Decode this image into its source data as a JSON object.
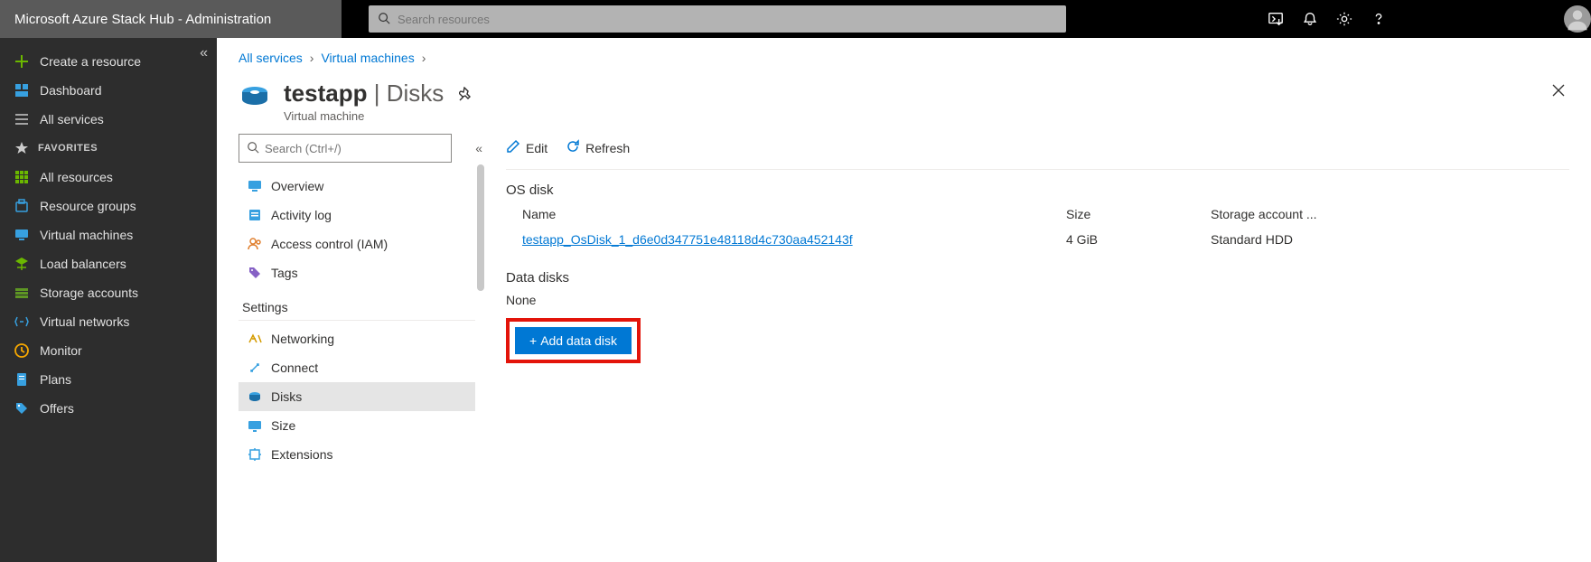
{
  "topbar": {
    "title": "Microsoft Azure Stack Hub - Administration",
    "search_placeholder": "Search resources"
  },
  "sidebar": {
    "create": "Create a resource",
    "dashboard": "Dashboard",
    "all_services": "All services",
    "favorites_label": "FAVORITES",
    "items": [
      {
        "label": "All resources"
      },
      {
        "label": "Resource groups"
      },
      {
        "label": "Virtual machines"
      },
      {
        "label": "Load balancers"
      },
      {
        "label": "Storage accounts"
      },
      {
        "label": "Virtual networks"
      },
      {
        "label": "Monitor"
      },
      {
        "label": "Plans"
      },
      {
        "label": "Offers"
      }
    ]
  },
  "breadcrumb": {
    "all_services": "All services",
    "vm": "Virtual machines"
  },
  "header": {
    "resource_name": "testapp",
    "blade_name": "Disks",
    "subtitle": "Virtual machine"
  },
  "res_menu": {
    "search_placeholder": "Search (Ctrl+/)",
    "overview": "Overview",
    "activity": "Activity log",
    "iam": "Access control (IAM)",
    "tags": "Tags",
    "settings_heading": "Settings",
    "networking": "Networking",
    "connect": "Connect",
    "disks": "Disks",
    "size": "Size",
    "extensions": "Extensions"
  },
  "cmd": {
    "edit": "Edit",
    "refresh": "Refresh"
  },
  "detail": {
    "os_disk_title": "OS disk",
    "col_name": "Name",
    "col_size": "Size",
    "col_storage": "Storage account ...",
    "os_disk_name": "testapp_OsDisk_1_d6e0d347751e48118d4c730aa452143f",
    "os_disk_size": "4 GiB",
    "os_disk_storage": "Standard HDD",
    "data_disks_title": "Data disks",
    "none": "None",
    "add_disk": "Add data disk"
  }
}
